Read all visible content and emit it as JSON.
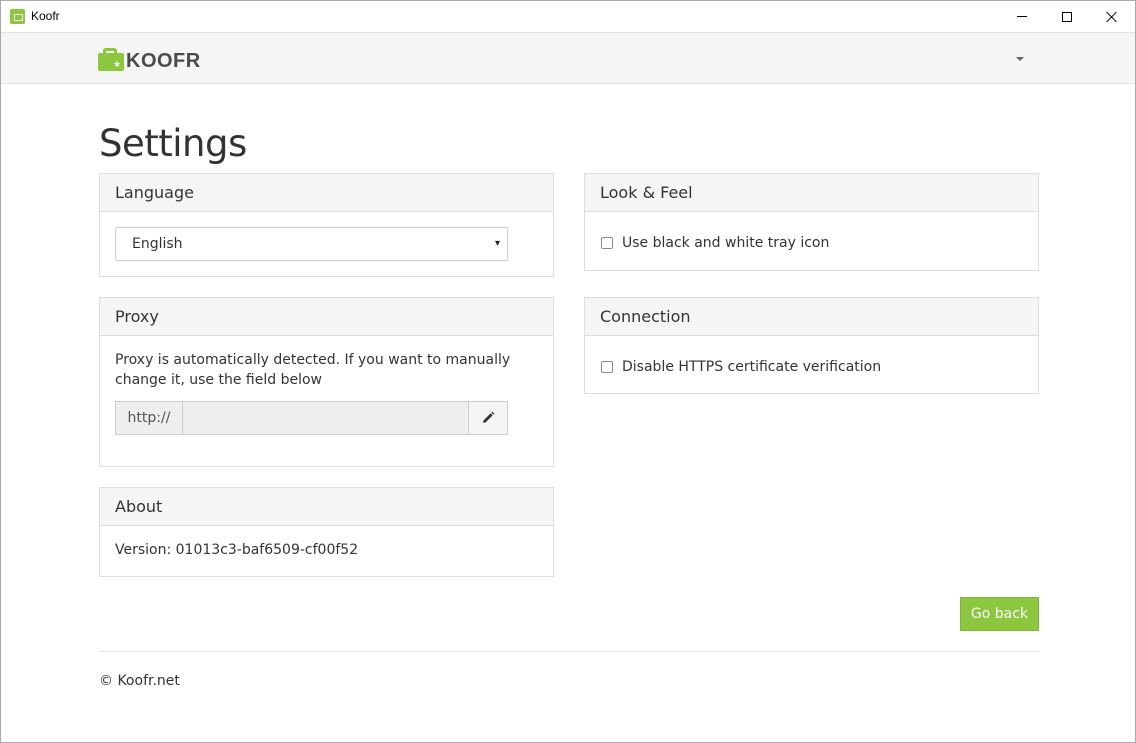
{
  "window": {
    "title": "Koofr",
    "controls": [
      "minimize-icon",
      "maximize-icon",
      "close-icon"
    ]
  },
  "header": {
    "logo_text": "KOOFR",
    "menu_icon": "caret-down-icon"
  },
  "page": {
    "title": "Settings"
  },
  "language": {
    "heading": "Language",
    "selected": "English",
    "arrow": "▾"
  },
  "proxy": {
    "heading": "Proxy",
    "description": "Proxy is automatically detected. If you want to manually change it, use the field below",
    "prefix": "http://",
    "value": "",
    "edit_icon": "pencil-icon"
  },
  "about": {
    "heading": "About",
    "version": "Version: 01013c3-baf6509-cf00f52"
  },
  "look_feel": {
    "heading": "Look & Feel",
    "bw_tray_label": "Use black and white tray icon",
    "bw_tray_checked": false
  },
  "connection": {
    "heading": "Connection",
    "https_label": "Disable HTTPS certificate verification",
    "https_checked": false
  },
  "actions": {
    "go_back": "Go back"
  },
  "footer": {
    "text": "© Koofr.net"
  },
  "colors": {
    "accent": "#8dc63f",
    "panel_heading_bg": "#f5f5f5",
    "border": "#dddddd"
  }
}
